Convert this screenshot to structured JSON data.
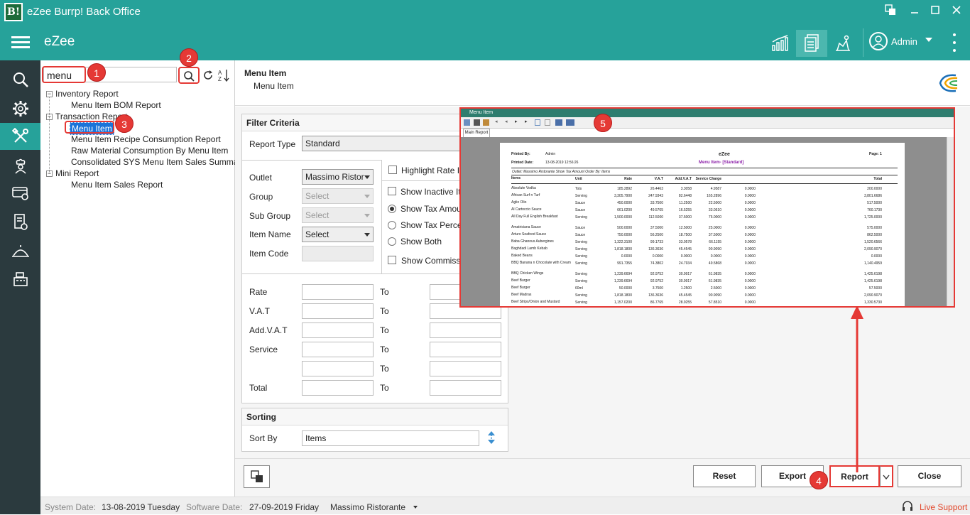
{
  "window": {
    "title": "eZee Burrp! Back Office",
    "logo_text": "B!"
  },
  "appbar": {
    "brand": "eZee",
    "user": "Admin"
  },
  "search": {
    "value": "menu"
  },
  "tree": {
    "groups": [
      {
        "label": "Inventory Report",
        "items": [
          "Menu Item BOM Report"
        ]
      },
      {
        "label": "Transaction Report",
        "items": [
          "Menu Item",
          "Menu Item Recipe Consumption Report",
          "Raw Material Consumption By Menu Item",
          "Consolidated SYS Menu Item Sales Summary"
        ]
      },
      {
        "label": "Mini Report",
        "items": [
          "Menu Item Sales Report"
        ]
      }
    ]
  },
  "header": {
    "title": "Menu Item",
    "subtitle": "Menu Item"
  },
  "filter": {
    "title": "Filter Criteria",
    "report_type_label": "Report Type",
    "report_type_value": "Standard",
    "outlet_label": "Outlet",
    "outlet_value": "Massimo Ristor",
    "group_label": "Group",
    "group_value": "Select",
    "subgroup_label": "Sub Group",
    "subgroup_value": "Select",
    "itemname_label": "Item Name",
    "itemname_value": "Select",
    "itemcode_label": "Item Code",
    "highlight_label": "Highlight Rate I",
    "inactive_label": "Show Inactive Ite",
    "tax_amount_label": "Show Tax Amour",
    "tax_percent_label": "Show Tax Percen",
    "both_label": "Show Both",
    "commission_label": "Show Commissi",
    "rate_label": "Rate",
    "vat_label": "V.A.T",
    "addvat_label": "Add.V.A.T",
    "service_label": "Service",
    "total_label": "Total",
    "to_label": "To"
  },
  "sorting": {
    "title": "Sorting",
    "sortby_label": "Sort By",
    "sortby_value": "Items"
  },
  "buttons": {
    "reset": "Reset",
    "export": "Export",
    "report": "Report",
    "close": "Close"
  },
  "status": {
    "system_date_label": "System Date:",
    "system_date": "13-08-2019 Tuesday",
    "software_date_label": "Software Date:",
    "software_date": "27-09-2019 Friday",
    "outlet": "Massimo Ristorante",
    "live_support": "Live Support"
  },
  "callouts": [
    "1",
    "2",
    "3",
    "4",
    "5"
  ],
  "preview": {
    "window_title": "Menu Item",
    "tab": "Main Report",
    "printed_by_label": "Printed By:",
    "printed_by": "Admin",
    "printed_date_label": "Printed Date:",
    "printed_date": "13-08-2019 12:56:26",
    "company": "eZee",
    "report_title": "Menu Item- [Standard]",
    "page_label": "Page: 1",
    "filter_line": "Outlet: Massimo Ristorante Show Tax Amount  Order By: Items",
    "columns": [
      "Items",
      "Unit",
      "Rate",
      "V.A.T",
      "Add.V.A.T",
      "Service Charge",
      "",
      "Total"
    ],
    "rows": [
      [
        "Absolute Vodka",
        "Tots",
        "185.2892",
        "26.4463",
        "3.3058",
        "4.9587",
        "0.0000",
        "200.0000"
      ],
      [
        "African Surf n Turf",
        "Serving",
        "3,305.7900",
        "247.9343",
        "82.6448",
        "165.2896",
        "0.0000",
        "3,801.6686"
      ],
      [
        "Aglio Olio",
        "Sauce",
        "450.0000",
        "33.7500",
        "11.2500",
        "22.5000",
        "0.0000",
        "517.5000"
      ],
      [
        "Al Cartoccio Sauce",
        "Sauce",
        "661.0200",
        "49.5765",
        "16.5255",
        "33.0510",
        "0.0000",
        "760.1730"
      ],
      [
        "All Day Full English Breakfast",
        "Serving",
        "1,500.0000",
        "112.5000",
        "37.5000",
        "75.0000",
        "0.0000",
        "1,725.0000"
      ],
      [
        "Amatriciana Sauce",
        "Sauce",
        "500.0000",
        "37.5000",
        "12.5000",
        "25.0000",
        "0.0000",
        "575.0000"
      ],
      [
        "Arturo Seafood Sauce",
        "Sauce",
        "750.0000",
        "56.2500",
        "18.7500",
        "37.5000",
        "0.0000",
        "862.5000"
      ],
      [
        "Baba Ghanous Aubergines",
        "Serving",
        "1,322.3100",
        "99.1733",
        "33.0578",
        "66.1155",
        "0.0000",
        "1,520.6566"
      ],
      [
        "Baghdadi Lamb Kebab",
        "Serving",
        "1,818.1800",
        "136.3636",
        "45.4545",
        "90.9090",
        "0.0000",
        "2,090.9070"
      ],
      [
        "Baked Beans",
        "Serving",
        "0.0000",
        "0.0000",
        "0.0000",
        "0.0000",
        "0.0000",
        "0.0000"
      ],
      [
        "BBQ Banana n Chocolate with Cream",
        "Serving",
        "991.7355",
        "74.3802",
        "24.7934",
        "49.5868",
        "0.0000",
        "1,140.4959"
      ],
      [
        "BBQ Chicken Wings",
        "Serving",
        "1,239.6694",
        "92.9752",
        "30.9917",
        "61.9835",
        "0.0000",
        "1,425.6198"
      ],
      [
        "Beef Burger",
        "Serving",
        "1,239.6694",
        "92.9752",
        "30.9917",
        "61.9835",
        "0.0000",
        "1,425.6198"
      ],
      [
        "Beef Burger",
        "60ml",
        "50.0000",
        "3.7500",
        "1.2500",
        "2.5000",
        "0.0000",
        "57.5000"
      ],
      [
        "Beef Madras",
        "Serving",
        "1,818.1800",
        "136.3636",
        "45.4545",
        "90.9090",
        "0.0000",
        "2,090.9070"
      ],
      [
        "Beef Strips/Onion and Mustard",
        "Serving",
        "1,157.0200",
        "86.7765",
        "28.9255",
        "57.8510",
        "0.0000",
        "1,330.5730"
      ]
    ]
  }
}
